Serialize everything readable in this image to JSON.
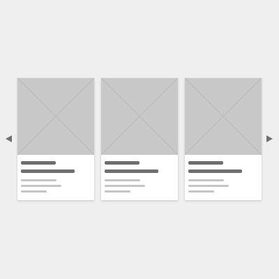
{
  "colors": {
    "background": "#efefef",
    "card": "#ffffff",
    "image_placeholder": "#c8c8c8",
    "placeholder_cross": "#b9b9b9",
    "title_line": "#6f6f6f",
    "text_line": "#c4c4c4",
    "arrow": "#707070"
  },
  "carousel": {
    "prev_icon": "triangle-left-icon",
    "next_icon": "triangle-right-icon",
    "cards": [
      {
        "image_icon": "image-placeholder-icon"
      },
      {
        "image_icon": "image-placeholder-icon"
      },
      {
        "image_icon": "image-placeholder-icon"
      }
    ]
  }
}
